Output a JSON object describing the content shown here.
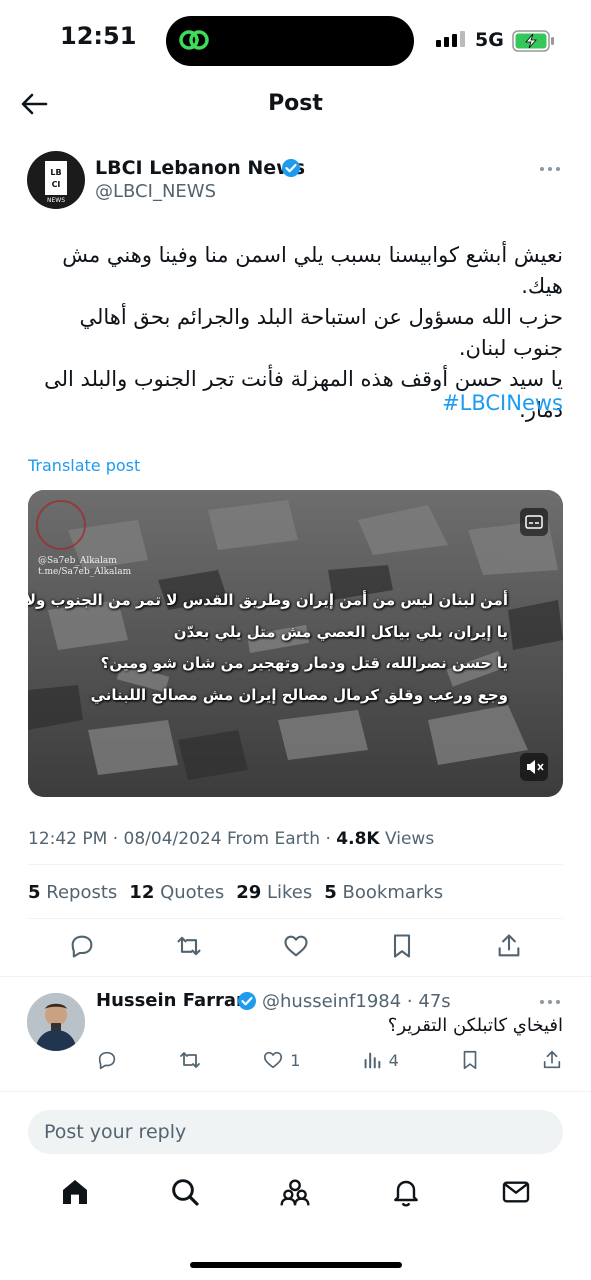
{
  "status_bar": {
    "time": "12:51",
    "network": "5G"
  },
  "header": {
    "title": "Post"
  },
  "post": {
    "author": {
      "name": "LBCI Lebanon News",
      "handle": "@LBCI_NEWS",
      "avatar_text": "LBCI",
      "avatar_sub": "NEWS"
    },
    "text_lines": [
      "نعيش أبشع كوابيسنا بسبب يلي اسمن منا وفينا وهني مش هيك.",
      "حزب الله مسؤول عن استباحة البلد والجرائم بحق أهالي جنوب لبنان.",
      "يا سيد حسن أوقف هذه المهزلة فأنت تجر الجنوب والبلد الى دمار."
    ],
    "hashtag": "#LBCINews",
    "translate_label": "Translate post",
    "media": {
      "watermark_1": "@Sa7eb_Alkalam",
      "watermark_2": "t.me/Sa7eb_Alkalam",
      "captions": [
        "أمن لبنان ليس من أمن إيران وطريق القدس لا تمر من الجنوب ولا من بيروت",
        "يا إيران، يلي بياكل العصي مش متل يلي بعدّن",
        "يا حسن نصرالله، قتل ودمار وتهجير من شان شو ومين؟",
        "وجع ورعب وقلق كرمال مصالح إيران مش مصالح اللبناني"
      ]
    },
    "meta": {
      "time": "12:42 PM",
      "date": "08/04/2024",
      "source": "From Earth",
      "views": "4.8K",
      "views_label": "Views"
    },
    "stats": [
      {
        "count": "5",
        "label": "Reposts"
      },
      {
        "count": "12",
        "label": "Quotes"
      },
      {
        "count": "29",
        "label": "Likes"
      },
      {
        "count": "5",
        "label": "Bookmarks"
      }
    ]
  },
  "reply": {
    "name": "Hussein Farran",
    "handle": "@husseinf1984 · 47s",
    "text": "افيخاي كاتبلكن التقرير؟",
    "likes": "1",
    "views": "4"
  },
  "composer": {
    "placeholder": "Post your reply"
  },
  "colors": {
    "accent": "#1d9bf0",
    "secondary_text": "#536471"
  }
}
